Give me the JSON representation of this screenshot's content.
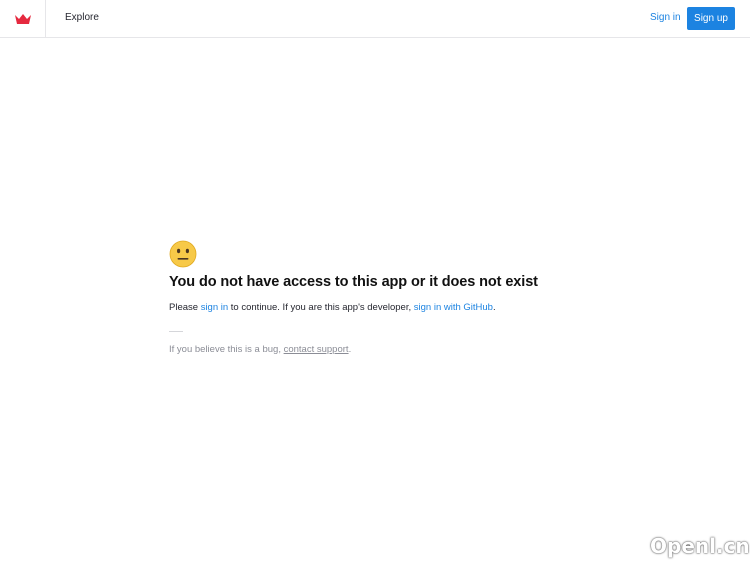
{
  "header": {
    "logo_icon": "crown-logo-icon",
    "explore_label": "Explore",
    "signin_label": "Sign in",
    "signup_label": "Sign up"
  },
  "main": {
    "emoji_icon": "neutral-face-emoji-icon",
    "heading": "You do not have access to this app or it does not exist",
    "line_prefix": "Please ",
    "signin_link": "sign in",
    "line_middle": " to continue. If you are this app's developer, ",
    "github_link": "sign in with GitHub",
    "line_suffix": ".",
    "bug_prefix": "If you believe this is a bug, ",
    "support_link": "contact support",
    "bug_suffix": "."
  },
  "watermark": "Openl.cn",
  "colors": {
    "accent": "#1c83e1",
    "logo": "#e5293f",
    "muted": "#8b8d96"
  }
}
